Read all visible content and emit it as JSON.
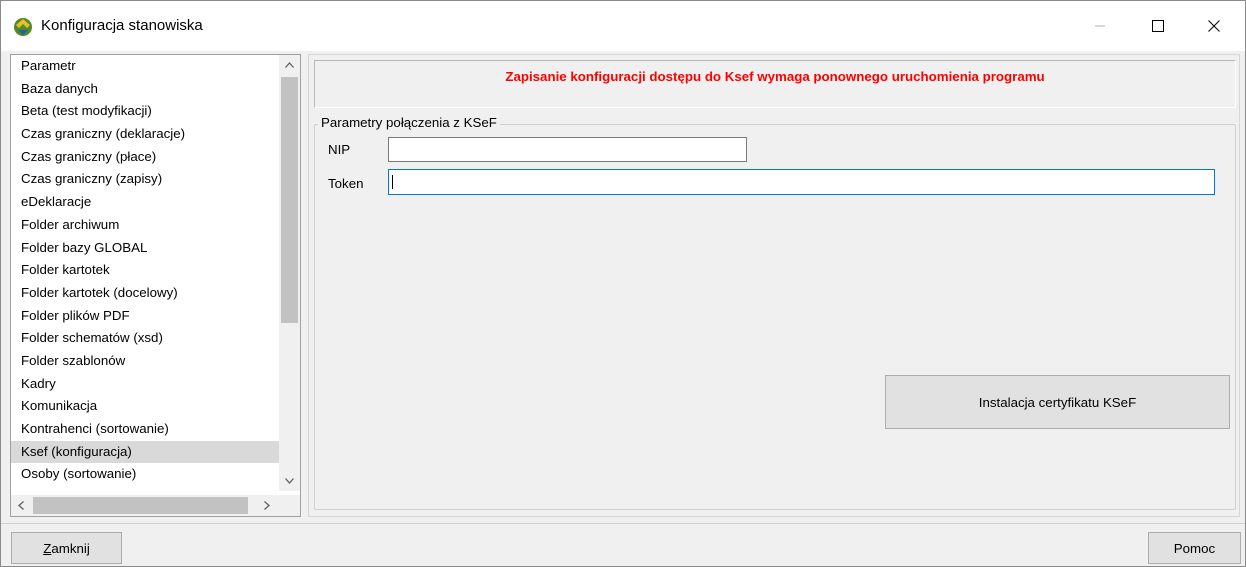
{
  "window": {
    "title": "Konfiguracja stanowiska"
  },
  "sidebar": {
    "items": [
      {
        "label": "Parametr"
      },
      {
        "label": "Baza danych"
      },
      {
        "label": "Beta (test modyfikacji)"
      },
      {
        "label": "Czas graniczny (deklaracje)"
      },
      {
        "label": "Czas graniczny (płace)"
      },
      {
        "label": "Czas graniczny (zapisy)"
      },
      {
        "label": "eDeklaracje"
      },
      {
        "label": "Folder archiwum"
      },
      {
        "label": "Folder bazy GLOBAL"
      },
      {
        "label": "Folder kartotek"
      },
      {
        "label": "Folder kartotek (docelowy)"
      },
      {
        "label": "Folder plików PDF"
      },
      {
        "label": "Folder schematów (xsd)"
      },
      {
        "label": "Folder szablonów"
      },
      {
        "label": "Kadry"
      },
      {
        "label": "Komunikacja"
      },
      {
        "label": "Kontrahenci (sortowanie)"
      },
      {
        "label": "Ksef (konfiguracja)"
      },
      {
        "label": "Osoby (sortowanie)"
      }
    ],
    "selected_label": "Ksef (konfiguracja)"
  },
  "main": {
    "notice": "Zapisanie konfiguracji dostępu do Ksef wymaga ponownego uruchomienia programu",
    "group_title": "Parametry połączenia z KSeF",
    "nip_label": "NIP",
    "nip_value": "",
    "token_label": "Token",
    "token_value": "",
    "cert_button": "Instalacja certyfikatu KSeF"
  },
  "footer": {
    "close_button": "Zamknij",
    "help_button": "Pomoc"
  },
  "colors": {
    "notice_text": "#ff0000",
    "selection": "#d9d9d9",
    "focus_border": "#0078d7"
  }
}
